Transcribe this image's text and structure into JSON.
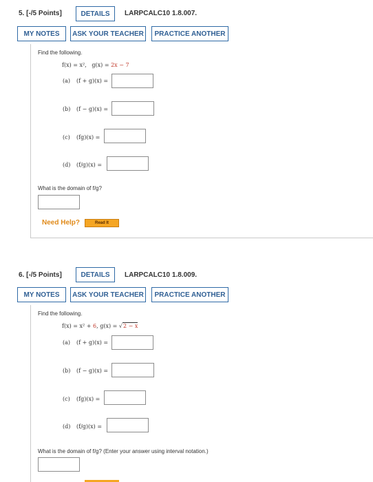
{
  "q5": {
    "title": "5. [-/5 Points]",
    "details_label": "DETAILS",
    "code": "LARPCALC10 1.8.007.",
    "my_notes_label": "MY NOTES",
    "ask_teacher_label": "ASK YOUR TEACHER",
    "practice_label": "PRACTICE ANOTHER",
    "instruction": "Find the following.",
    "f_def": "f(x) = x², ",
    "g_def_prefix": "g(x) = ",
    "g_def_value": "2x − 7",
    "parts": [
      {
        "label": "(a)",
        "expr": "(f + g)(x) =",
        "value": ""
      },
      {
        "label": "(b)",
        "expr": "(f − g)(x) =",
        "value": ""
      },
      {
        "label": "(c)",
        "expr": "(fg)(x) =",
        "value": ""
      },
      {
        "label": "(d)",
        "expr": "(f/g)(x) =",
        "value": ""
      }
    ],
    "domain_question": "What is the domain of f/g?",
    "domain_value": "",
    "need_help": "Need Help?",
    "read_it": "Read It"
  },
  "q6": {
    "title": "6. [-/5 Points]",
    "details_label": "DETAILS",
    "code": "LARPCALC10 1.8.009.",
    "my_notes_label": "MY NOTES",
    "ask_teacher_label": "ASK YOUR TEACHER",
    "practice_label": "PRACTICE ANOTHER",
    "instruction": "Find the following.",
    "f_def_prefix": "f(x) = x² + ",
    "f_def_value": "6",
    "g_def_prefix": ",   g(x) = √",
    "g_def_value": "2 − x",
    "parts": [
      {
        "label": "(a)",
        "expr": "(f + g)(x) =",
        "value": ""
      },
      {
        "label": "(b)",
        "expr": "(f − g)(x) =",
        "value": ""
      },
      {
        "label": "(c)",
        "expr": "(fg)(x) =",
        "value": ""
      },
      {
        "label": "(d)",
        "expr": "(f/g)(x) =",
        "value": ""
      }
    ],
    "domain_question": "What is the domain of f/g? (Enter your answer using interval notation.)",
    "domain_value": ""
  }
}
